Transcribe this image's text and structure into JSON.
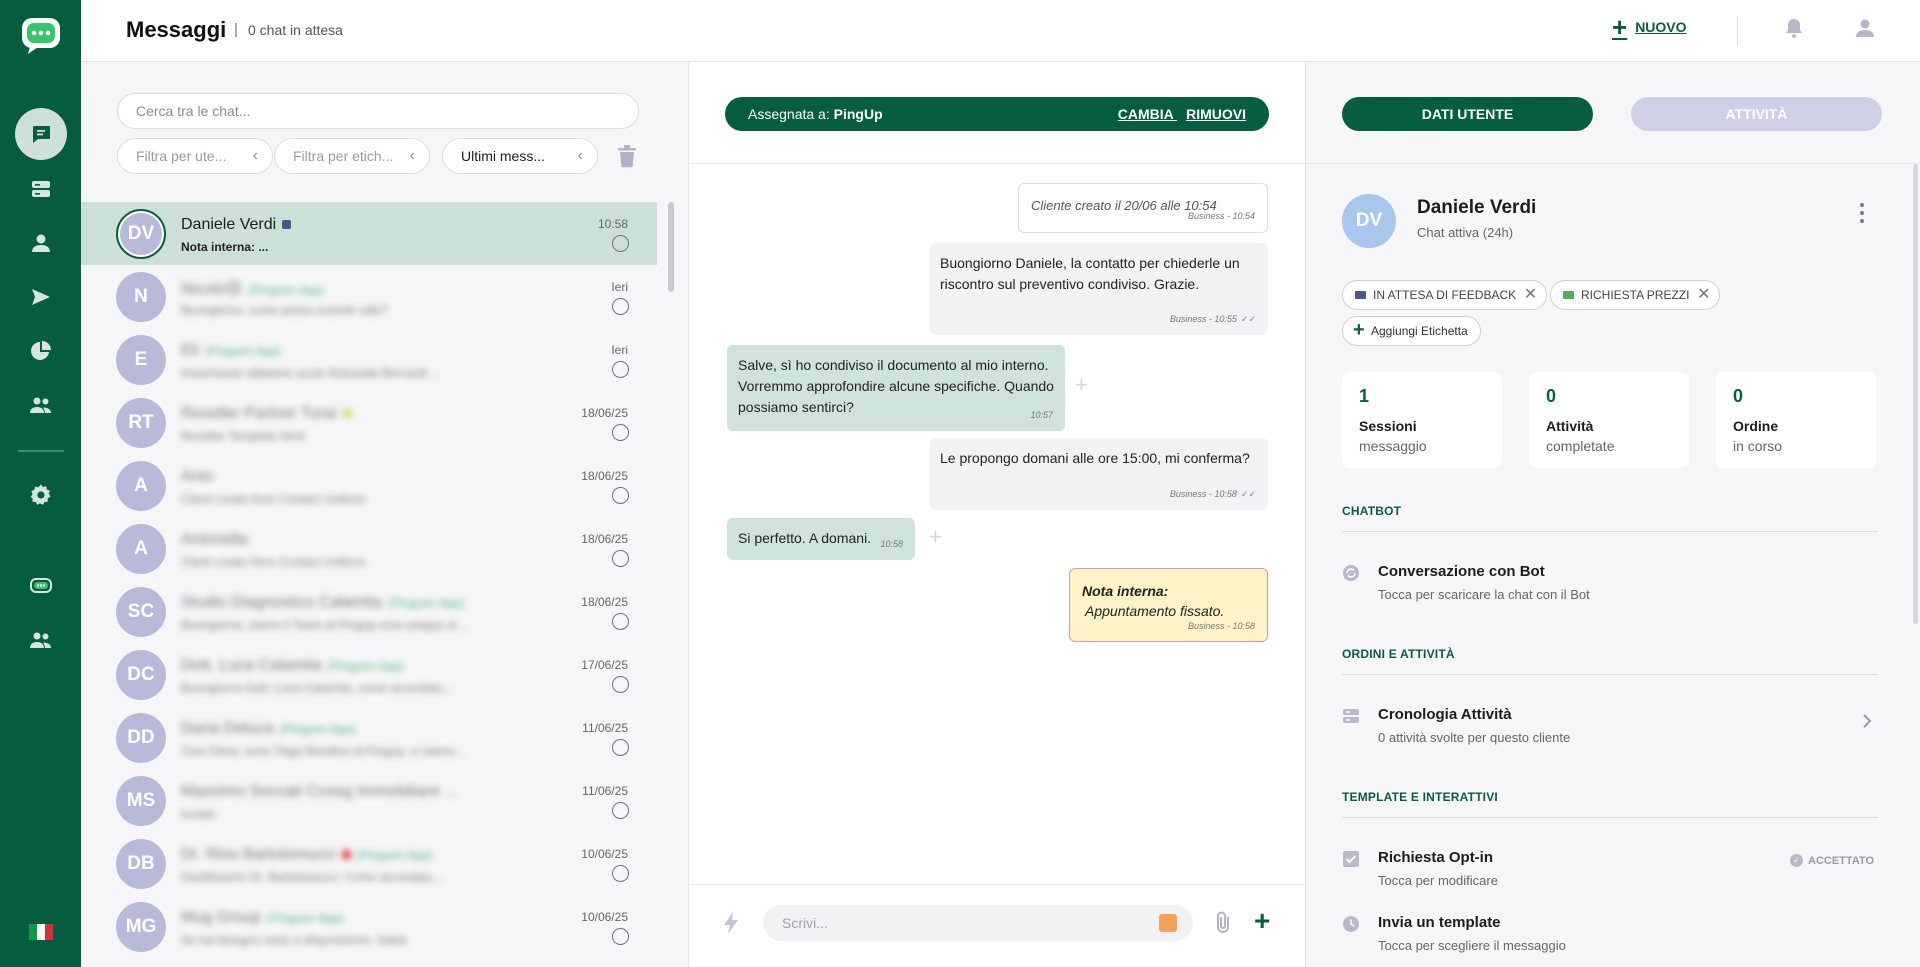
{
  "header": {
    "title": "Messaggi",
    "separator": "|",
    "waiting": "0 chat in attesa",
    "new_label": "NUOVO"
  },
  "list": {
    "search_placeholder": "Cerca tra le chat...",
    "filters": [
      {
        "label": "Filtra per ute..."
      },
      {
        "label": "Filtra per etich..."
      },
      {
        "label": "Ultimi mess..."
      }
    ],
    "rows": [
      {
        "initials": "DV",
        "name": "Daniele Verdi",
        "tag": "",
        "preview": "Nota interna: ...",
        "time": "10:58",
        "dot": "#4d5591"
      },
      {
        "initials": "N",
        "name": "Nicolò😍",
        "tag": "(Pinguen App)",
        "preview": "Buongiorno, come posso esserle utile?",
        "time": "Ieri",
        "dot": ""
      },
      {
        "initials": "E",
        "name": "Eli",
        "tag": "(Pinguen App)",
        "preview": "Inserimento abbiamo avuto Antonella Bernardi ...",
        "time": "Ieri",
        "dot": ""
      },
      {
        "initials": "RT",
        "name": "Reseller Partner Turai",
        "tag": "",
        "preview": "Reseller Template Sent",
        "time": "18/06/25",
        "dot": "#c6df5e"
      },
      {
        "initials": "A",
        "name": "Anto",
        "tag": "",
        "preview": "Client creato form Contact Uniform",
        "time": "18/06/25",
        "dot": ""
      },
      {
        "initials": "A",
        "name": "Antonella",
        "tag": "",
        "preview": "Client creato form Contact Uniform",
        "time": "18/06/25",
        "dot": ""
      },
      {
        "initials": "SC",
        "name": "Studio Diagnostico Calamita",
        "tag": "(Pinguen App)",
        "preview": "Buongiorno, siamo il Team di Pingup esso pregus ai ...",
        "time": "18/06/25",
        "dot": ""
      },
      {
        "initials": "DC",
        "name": "Dott. Luca Calamita",
        "tag": "(Pinguen App)",
        "preview": "Buongiorno Dott. Luca Calamita, come accordato...",
        "time": "17/06/25",
        "dot": ""
      },
      {
        "initials": "DD",
        "name": "Daria Deluca",
        "tag": "(Pinguen App)",
        "preview": "Ciao Daria, sono Tiago Bandino di Pingup, ci siamo...",
        "time": "11/06/25",
        "dot": ""
      },
      {
        "initials": "MS",
        "name": "Massimo Soccati Coseg Immobiliare ...",
        "tag": "",
        "preview": "inviato",
        "time": "11/06/25",
        "dot": ""
      },
      {
        "initials": "DB",
        "name": "Dr. Rino Bartolomucci",
        "tag": "(Pinguen App)",
        "preview": "Gentilissimo Dr. Bartolomucci. Come accordato...",
        "time": "10/06/25",
        "dot": "#e0413f"
      },
      {
        "initials": "MG",
        "name": "Mug Group",
        "tag": "(Pinguen App)",
        "preview": "Se hai bisogno resto a disposizione. Saluti",
        "time": "10/06/25",
        "dot": ""
      }
    ]
  },
  "chat": {
    "assigned_prefix": "Assegnata a:",
    "assigned_to": "PingUp",
    "change_label": "CAMBIA",
    "remove_label": "RIMUOVI",
    "messages": [
      {
        "kind": "sys",
        "text": "Cliente creato il 20/06 alle 10:54",
        "meta": "Business - 10:54"
      },
      {
        "kind": "out",
        "text": "Buongiorno Daniele, la contatto per chiederle un riscontro sul preventivo condiviso. Grazie.",
        "meta": "Business - 10:55",
        "ticks": "✓✓"
      },
      {
        "kind": "in",
        "text": "Salve, sì ho condiviso il documento al mio interno. Vorremmo approfondire alcune specifiche. Quando possiamo sentirci?",
        "meta": "10:57"
      },
      {
        "kind": "out",
        "text": "Le propongo domani alle ore 15:00, mi conferma?",
        "meta": "Business - 10:58",
        "ticks": "✓✓"
      },
      {
        "kind": "in",
        "text": "Si perfetto. A domani.",
        "meta": "10:58"
      },
      {
        "kind": "note",
        "title": "Nota interna:",
        "text": "Appuntamento fissato.",
        "meta": "Business - 10:58"
      }
    ],
    "input_placeholder": "Scrivi..."
  },
  "detail": {
    "tab_user": "DATI UTENTE",
    "tab_activity": "ATTIVITÀ",
    "initials": "DV",
    "name": "Daniele Verdi",
    "status": "Chat attiva (24h)",
    "tags": [
      {
        "label": "IN ATTESA DI FEEDBACK",
        "color": "#4d5591"
      },
      {
        "label": "RICHIESTA PREZZI",
        "color": "#4cae63"
      }
    ],
    "add_tag": "Aggiungi Etichetta",
    "stats": [
      {
        "value": "1",
        "label": "Sessioni",
        "sub": "messaggio"
      },
      {
        "value": "0",
        "label": "Attività",
        "sub": "completate"
      },
      {
        "value": "0",
        "label": "Ordine",
        "sub": "in corso"
      }
    ],
    "sec_chatbot": "CHATBOT",
    "bot_title": "Conversazione con Bot",
    "bot_sub": "Tocca per scaricare la chat con il Bot",
    "sec_orders": "ORDINI E ATTIVITÀ",
    "history_title": "Cronologia Attività",
    "history_sub": "0 attività svolte per questo cliente",
    "sec_templates": "TEMPLATE E INTERATTIVI",
    "optin_title": "Richiesta Opt-in",
    "optin_sub": "Tocca per modificare",
    "optin_status": "ACCETTATO",
    "template_title": "Invia un template",
    "template_sub": "Tocca per scegliere il messaggio"
  },
  "colors": {
    "brand": "#075d3f",
    "active_row": "#cce0d7",
    "incoming_bubble": "#cfe3db",
    "note_bubble": "#fdf3c7"
  },
  "icons": [
    "chat-bubble-icon",
    "stack-icon",
    "person-icon",
    "send-icon",
    "pie-chart-icon",
    "group-icon",
    "gear-icon",
    "bot-icon",
    "team-icon",
    "bell-icon",
    "user-icon",
    "trash-icon",
    "bolt-icon",
    "paperclip-icon",
    "plus-icon",
    "kebab-icon",
    "checkbox-icon",
    "clock-icon",
    "chevron-right-icon"
  ]
}
